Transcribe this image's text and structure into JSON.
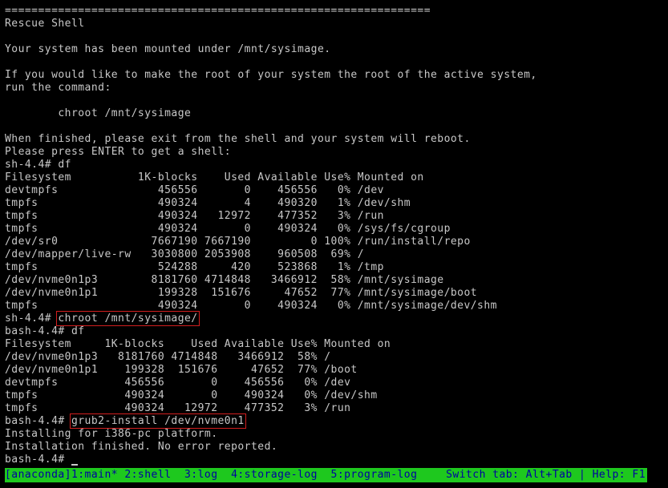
{
  "terminal": {
    "rule": "================================================================",
    "lines": [
      "================================================================",
      "Rescue Shell",
      "",
      "Your system has been mounted under /mnt/sysimage.",
      "",
      "If you would like to make the root of your system the root of the active system,",
      "run the command:",
      "",
      "        chroot /mnt/sysimage",
      "",
      "When finished, please exit from the shell and your system will reboot.",
      "Please press ENTER to get a shell:",
      "sh-4.4# df",
      "Filesystem          1K-blocks    Used Available Use% Mounted on",
      "devtmpfs               456556       0    456556   0% /dev",
      "tmpfs                  490324       4    490320   1% /dev/shm",
      "tmpfs                  490324   12972    477352   3% /run",
      "tmpfs                  490324       0    490324   0% /sys/fs/cgroup",
      "/dev/sr0              7667190 7667190         0 100% /run/install/repo",
      "/dev/mapper/live-rw   3030800 2053908    960508  69% /",
      "tmpfs                  524288     420    523868   1% /tmp",
      "/dev/nvme0n1p3        8181760 4714848   3466912  58% /mnt/sysimage",
      "/dev/nvme0n1p1         199328  151676     47652  77% /mnt/sysimage/boot",
      "tmpfs                  490324       0    490324   0% /mnt/sysimage/dev/shm"
    ],
    "chroot_prompt": "sh-4.4# ",
    "chroot_command": "chroot /mnt/sysimage/",
    "lines2": [
      "bash-4.4# df",
      "Filesystem     1K-blocks    Used Available Use% Mounted on",
      "/dev/nvme0n1p3   8181760 4714848   3466912  58% /",
      "/dev/nvme0n1p1    199328  151676     47652  77% /boot",
      "devtmpfs          456556       0    456556   0% /dev",
      "tmpfs             490324       0    490324   0% /dev/shm",
      "tmpfs             490324   12972    477352   3% /run"
    ],
    "grub_prompt": "bash-4.4# ",
    "grub_command": "grub2-install /dev/nvme0n1",
    "lines3": [
      "Installing for i386-pc platform.",
      "Installation finished. No error reported."
    ],
    "last_prompt": "bash-4.4# "
  },
  "status_bar": {
    "left": "[anaconda]1:main* 2:shell  3:log  4:storage-log  5:program-log",
    "right": "Switch tab: Alt+Tab | Help: F1"
  },
  "colors": {
    "background": "#000000",
    "text": "#c8c8c8",
    "status_bg": "#1ec81e",
    "status_text": "#0000a0",
    "highlight_box": "#d21e1e"
  }
}
